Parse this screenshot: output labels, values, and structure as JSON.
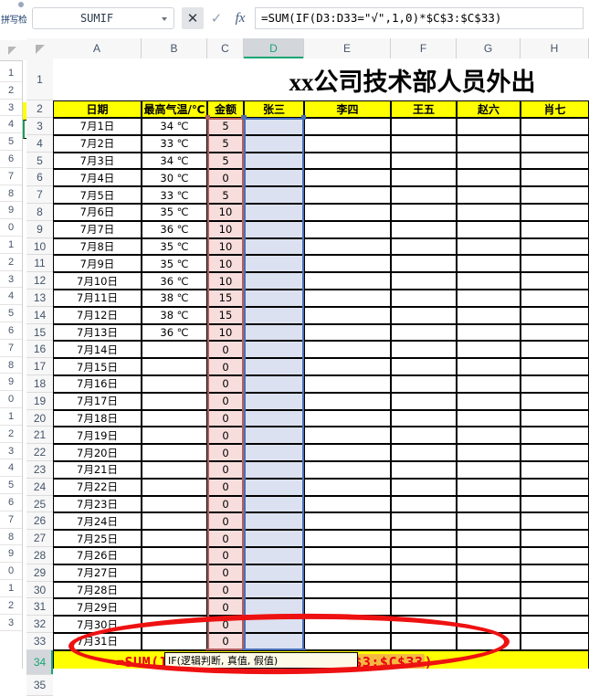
{
  "background_window": {
    "ribbon_label": "拼写检",
    "row_numbers": [
      "1",
      "2",
      "3",
      "4",
      "5",
      "6",
      "7",
      "8",
      "9",
      "0",
      "1",
      "2",
      "3",
      "4",
      "5",
      "6",
      "7",
      "8",
      "9",
      "0",
      "1",
      "2",
      "3",
      "4",
      "5",
      "6",
      "7",
      "8",
      "9",
      "0",
      "1",
      "2",
      "3"
    ]
  },
  "formula_bar": {
    "name_box_value": "SUMIF",
    "cancel_icon": "close-icon",
    "enter_icon": "check-icon",
    "function_icon": "fx-icon",
    "formula": "=SUM(IF(D3:D33=\"√\",1,0)*$C$3:$C$33)"
  },
  "columns": [
    "A",
    "B",
    "C",
    "D",
    "E",
    "F",
    "G",
    "H"
  ],
  "selected_column": "D",
  "rows": [
    "1",
    "2",
    "3",
    "4",
    "5",
    "6",
    "7",
    "8",
    "9",
    "10",
    "11",
    "12",
    "13",
    "14",
    "15",
    "16",
    "17",
    "18",
    "19",
    "20",
    "21",
    "22",
    "23",
    "24",
    "25",
    "26",
    "27",
    "28",
    "29",
    "30",
    "31",
    "32",
    "33",
    "34",
    "35"
  ],
  "selected_row": "34",
  "sheet": {
    "title": "xx公司技术部人员外出",
    "headers": [
      "日期",
      "最高气温/℃",
      "金额",
      "张三",
      "李四",
      "王五",
      "赵六",
      "肖七"
    ],
    "data": [
      {
        "row": "3",
        "date": "7月1日",
        "temp": "34 ℃",
        "amount": "5"
      },
      {
        "row": "4",
        "date": "7月2日",
        "temp": "33 ℃",
        "amount": "5"
      },
      {
        "row": "5",
        "date": "7月3日",
        "temp": "34 ℃",
        "amount": "5"
      },
      {
        "row": "6",
        "date": "7月4日",
        "temp": "30 ℃",
        "amount": "0"
      },
      {
        "row": "7",
        "date": "7月5日",
        "temp": "33 ℃",
        "amount": "5"
      },
      {
        "row": "8",
        "date": "7月6日",
        "temp": "35 ℃",
        "amount": "10"
      },
      {
        "row": "9",
        "date": "7月7日",
        "temp": "36 ℃",
        "amount": "10"
      },
      {
        "row": "10",
        "date": "7月8日",
        "temp": "35 ℃",
        "amount": "10"
      },
      {
        "row": "11",
        "date": "7月9日",
        "temp": "35 ℃",
        "amount": "10"
      },
      {
        "row": "12",
        "date": "7月10日",
        "temp": "36 ℃",
        "amount": "10"
      },
      {
        "row": "13",
        "date": "7月11日",
        "temp": "38 ℃",
        "amount": "15"
      },
      {
        "row": "14",
        "date": "7月12日",
        "temp": "38 ℃",
        "amount": "15"
      },
      {
        "row": "15",
        "date": "7月13日",
        "temp": "36 ℃",
        "amount": "10"
      },
      {
        "row": "16",
        "date": "7月14日",
        "temp": "",
        "amount": "0"
      },
      {
        "row": "17",
        "date": "7月15日",
        "temp": "",
        "amount": "0"
      },
      {
        "row": "18",
        "date": "7月16日",
        "temp": "",
        "amount": "0"
      },
      {
        "row": "19",
        "date": "7月17日",
        "temp": "",
        "amount": "0"
      },
      {
        "row": "20",
        "date": "7月18日",
        "temp": "",
        "amount": "0"
      },
      {
        "row": "21",
        "date": "7月19日",
        "temp": "",
        "amount": "0"
      },
      {
        "row": "22",
        "date": "7月20日",
        "temp": "",
        "amount": "0"
      },
      {
        "row": "23",
        "date": "7月21日",
        "temp": "",
        "amount": "0"
      },
      {
        "row": "24",
        "date": "7月22日",
        "temp": "",
        "amount": "0"
      },
      {
        "row": "25",
        "date": "7月23日",
        "temp": "",
        "amount": "0"
      },
      {
        "row": "26",
        "date": "7月24日",
        "temp": "",
        "amount": "0"
      },
      {
        "row": "27",
        "date": "7月25日",
        "temp": "",
        "amount": "0"
      },
      {
        "row": "28",
        "date": "7月26日",
        "temp": "",
        "amount": "0"
      },
      {
        "row": "29",
        "date": "7月27日",
        "temp": "",
        "amount": "0"
      },
      {
        "row": "30",
        "date": "7月28日",
        "temp": "",
        "amount": "0"
      },
      {
        "row": "31",
        "date": "7月29日",
        "temp": "",
        "amount": "0"
      },
      {
        "row": "32",
        "date": "7月30日",
        "temp": "",
        "amount": "0"
      },
      {
        "row": "33",
        "date": "7月31日",
        "temp": "",
        "amount": "0"
      }
    ],
    "entry_row": {
      "row": "34",
      "segments": [
        {
          "text": "=SUM",
          "style": "plain"
        },
        {
          "text": "(",
          "style": "plain"
        },
        {
          "text": "IF",
          "style": "plain"
        },
        {
          "text": "(",
          "style": "paren-blue"
        },
        {
          "text": "D3:D33",
          "style": "range-d"
        },
        {
          "text": "=\" √\",1,0",
          "style": "plain"
        },
        {
          "text": ")",
          "style": "paren-blue"
        },
        {
          "text": "*",
          "style": "plain"
        },
        {
          "text": "$C$3:$C$33",
          "style": "range-c"
        },
        {
          "text": ")",
          "style": "plain"
        }
      ]
    },
    "selected_ranges": [
      {
        "name": "amount-range",
        "ref": "C3:C33",
        "color": "#b06060"
      },
      {
        "name": "zhangsan-range",
        "ref": "D3:D33",
        "color": "#4a6fb5"
      }
    ]
  },
  "tooltip": "IF(逻辑判断, 真值, 假值)",
  "colors": {
    "header_fill": "#ffff00",
    "amount_range_fill": "#f7dedd",
    "name_range_fill": "#dbe1f0",
    "annotation": "#ee1111",
    "formula_text": "#e8000d",
    "selection_accent": "#17a673"
  }
}
